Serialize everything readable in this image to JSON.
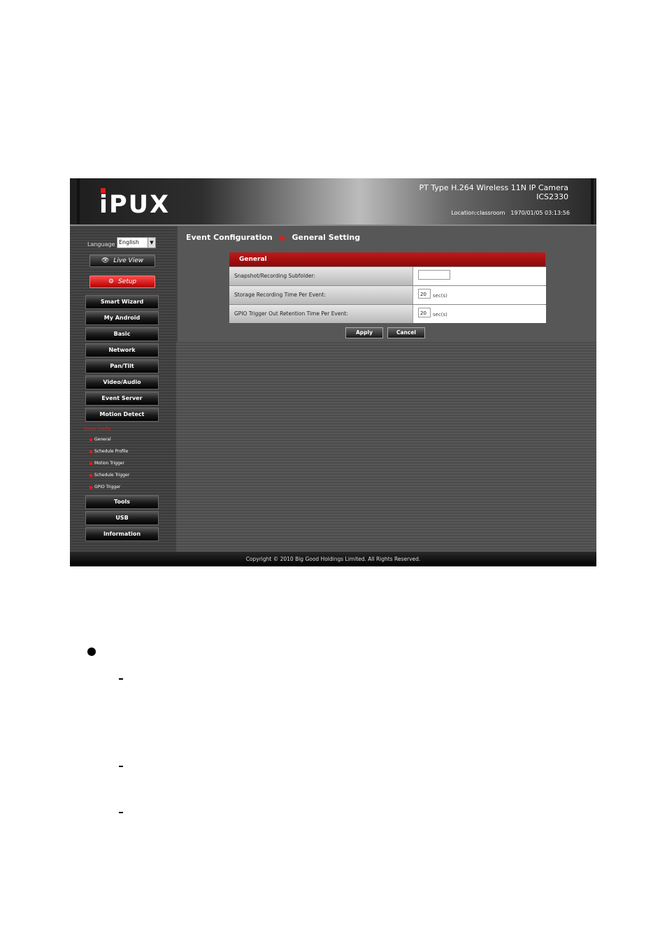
{
  "header": {
    "logo": "iPUX",
    "model_line1": "PT Type H.264 Wireless 11N IP Camera",
    "model_line2": "ICS2330",
    "location": "Location:classroom",
    "datetime": "1970/01/05 03:13:56"
  },
  "sidebar": {
    "language_label": "Language",
    "language_value": "English",
    "live_view": "Live View",
    "setup": "Setup",
    "nav_top": [
      "Smart Wizard",
      "My Android",
      "Basic",
      "Network",
      "Pan/Tilt",
      "Video/Audio",
      "Event Server",
      "Motion Detect"
    ],
    "event_group_label": "Event Config",
    "event_subitems": [
      "General",
      "Schedule Profile",
      "Motion Trigger",
      "Schedule Trigger",
      "GPIO Trigger"
    ],
    "nav_bottom": [
      "Tools",
      "USB",
      "Information"
    ]
  },
  "main": {
    "breadcrumb_section": "Event Configuration",
    "breadcrumb_page": "General Setting",
    "panel_title": "General",
    "rows": [
      {
        "label": "Snapshot/Recording Subfolder:",
        "value": "",
        "unit": ""
      },
      {
        "label": "Storage Recording Time Per Event:",
        "value": "20",
        "unit": "sec(s)"
      },
      {
        "label": "GPIO Trigger Out Retention Time Per Event:",
        "value": "20",
        "unit": "sec(s)"
      }
    ],
    "apply_label": "Apply",
    "cancel_label": "Cancel"
  },
  "footer": {
    "copyright": "Copyright © 2010 Big Good Holdings Limited. All Rights Reserved."
  },
  "colors": {
    "accent_red": "#e01c1c",
    "panel_header": "#b01515"
  },
  "icons": {
    "live_view": "eye-icon",
    "setup": "gear-icon",
    "bullet": "square-bullet-icon"
  }
}
